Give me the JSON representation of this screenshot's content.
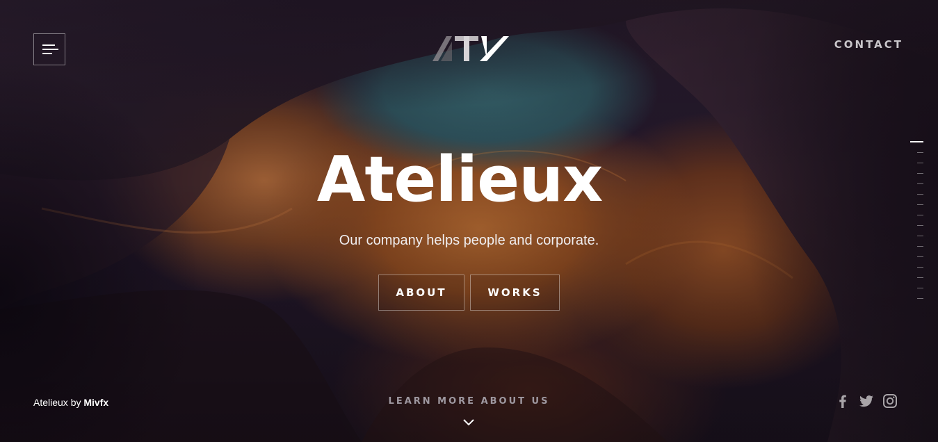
{
  "header": {
    "menu_icon": "hamburger-menu-icon",
    "logo_text": "ATV",
    "contact_label": "CONTACT"
  },
  "hero": {
    "title": "Atelieux",
    "subtitle": "Our company helps people and corporate.",
    "buttons": [
      {
        "label": "ABOUT"
      },
      {
        "label": "WORKS"
      }
    ]
  },
  "side_nav": {
    "count": 16,
    "active_index": 0
  },
  "footer": {
    "credit_prefix": "Atelieux by",
    "credit_author": "Mivfx",
    "learn_more_label": "LEARN MORE ABOUT US",
    "scroll_icon": "chevron-down-icon",
    "social": [
      {
        "name": "facebook-icon"
      },
      {
        "name": "twitter-icon"
      },
      {
        "name": "instagram-icon"
      }
    ]
  },
  "colors": {
    "text_primary": "#ffffff",
    "text_muted": "#9e98a0",
    "contact": "#c9c6ca",
    "sky": "#356069",
    "rock": "#a5612e"
  }
}
